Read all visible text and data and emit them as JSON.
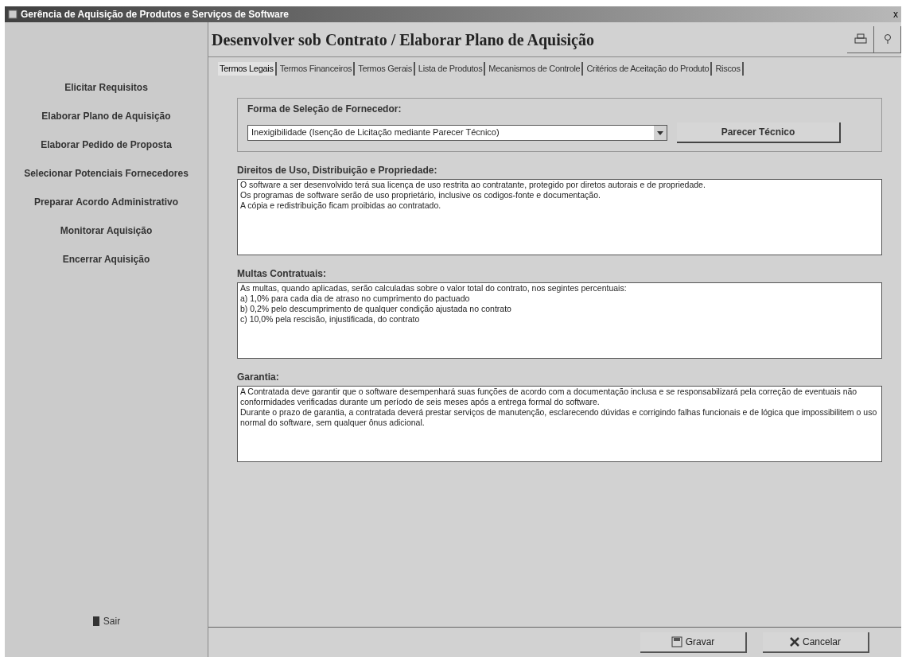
{
  "window": {
    "title": "Gerência de Aquisição de Produtos e Serviços de Software",
    "close": "x"
  },
  "sidebar": {
    "items": [
      {
        "label": "Elicitar Requisitos",
        "selected": false
      },
      {
        "label": "Elaborar Plano de Aquisição",
        "selected": false
      },
      {
        "label": "Elaborar Pedido de Proposta",
        "selected": false
      },
      {
        "label": "Selecionar Potenciais Fornecedores",
        "selected": false
      },
      {
        "label": "Preparar Acordo Administrativo",
        "selected": false
      },
      {
        "label": "Monitorar Aquisição",
        "selected": false
      },
      {
        "label": "Encerrar Aquisição",
        "selected": false
      }
    ],
    "exit": "Sair"
  },
  "header": {
    "title": "Desenvolver sob Contrato / Elaborar Plano de Aquisição"
  },
  "tabs": [
    {
      "label": "Termos Legais",
      "selected": true
    },
    {
      "label": "Termos Financeiros",
      "selected": false
    },
    {
      "label": "Termos Gerais",
      "selected": false
    },
    {
      "label": "Lista de Produtos",
      "selected": false
    },
    {
      "label": "Mecanismos de Controle",
      "selected": false
    },
    {
      "label": "Critérios de Aceitação do Produto",
      "selected": false
    },
    {
      "label": "Riscos",
      "selected": false
    }
  ],
  "supplier_selection": {
    "label": "Forma de Seleção de Fornecedor:",
    "value": "Inexigibilidade (Isenção de Licitação mediante Parecer Técnico)",
    "button": "Parecer Técnico"
  },
  "sections": [
    {
      "label": "Direitos de Uso, Distribuição e Propriedade:",
      "value": "O software a ser desenvolvido terá sua licença de uso restrita ao contratante, protegido por diretos autorais e de propriedade.\nOs programas de software serão de uso proprietário, inclusive os codigos-fonte e documentação.\nA cópia e redistribuição ficam proibidas ao contratado."
    },
    {
      "label": "Multas Contratuais:",
      "value": "As multas, quando aplicadas, serão calculadas sobre o valor total do contrato, nos segintes percentuais:\na) 1,0% para cada dia de atraso no cumprimento do pactuado\nb) 0,2% pelo descumprimento de qualquer condição ajustada no contrato\nc) 10,0% pela rescisão, injustificada, do contrato"
    },
    {
      "label": "Garantia:",
      "value": "A Contratada deve garantir que o software desempenhará suas funções de acordo com a documentação inclusa e se responsabilizará pela correção de eventuais não conformidades verificadas durante um período de seis meses após a entrega formal do software.\nDurante o prazo de garantia, a contratada deverá prestar serviços de manutenção, esclarecendo dúvidas e corrigindo falhas funcionais e de lógica que impossibilitem o uso normal do software, sem qualquer ônus adicional."
    }
  ],
  "footer": {
    "buttons": [
      {
        "kind": "save",
        "label": "Gravar"
      },
      {
        "kind": "cancel",
        "label": "Cancelar"
      }
    ]
  }
}
